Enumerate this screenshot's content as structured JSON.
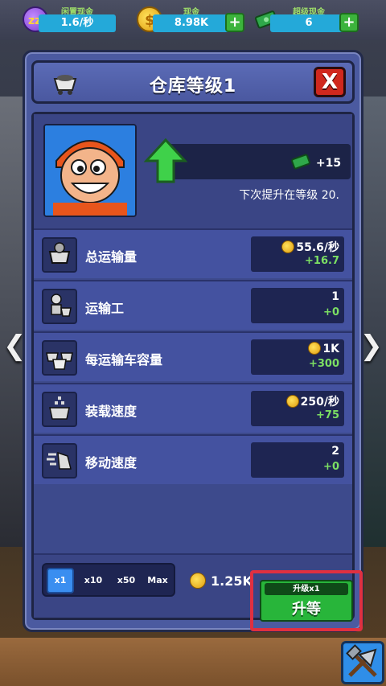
{
  "topbar": {
    "idle_cash": {
      "label": "闲置现金",
      "value": "1.6/秒"
    },
    "cash": {
      "label": "现金",
      "value": "8.98K",
      "plus": "+"
    },
    "super_cash": {
      "label": "超级现金",
      "value": "6",
      "plus": "+"
    }
  },
  "panel": {
    "title": "仓库等级1",
    "close_label": "X",
    "level": {
      "reward": "+15",
      "next_boost_text": "下次提升在等级 20."
    },
    "stats": [
      {
        "label": "总运输量",
        "value": "55.6/秒",
        "delta": "+16.7",
        "has_coin": true
      },
      {
        "label": "运输工",
        "value": "1",
        "delta": "+0",
        "has_coin": false
      },
      {
        "label": "每运输车容量",
        "value": "1K",
        "delta": "+300",
        "has_coin": true
      },
      {
        "label": "装载速度",
        "value": "250/秒",
        "delta": "+75",
        "has_coin": true
      },
      {
        "label": "移动速度",
        "value": "2",
        "delta": "+0",
        "has_coin": false
      }
    ],
    "multipliers": [
      "x1",
      "x10",
      "x50",
      "Max"
    ],
    "active_multiplier": "x1",
    "cost": "1.25K",
    "upgrade": {
      "top_label": "升级x1",
      "label": "升等"
    }
  },
  "nav": {
    "left": "❮",
    "right": "❯"
  },
  "colors": {
    "accent_green": "#28b53a",
    "highlight_red": "#e03040",
    "panel_blue": "#4b5aa0"
  }
}
